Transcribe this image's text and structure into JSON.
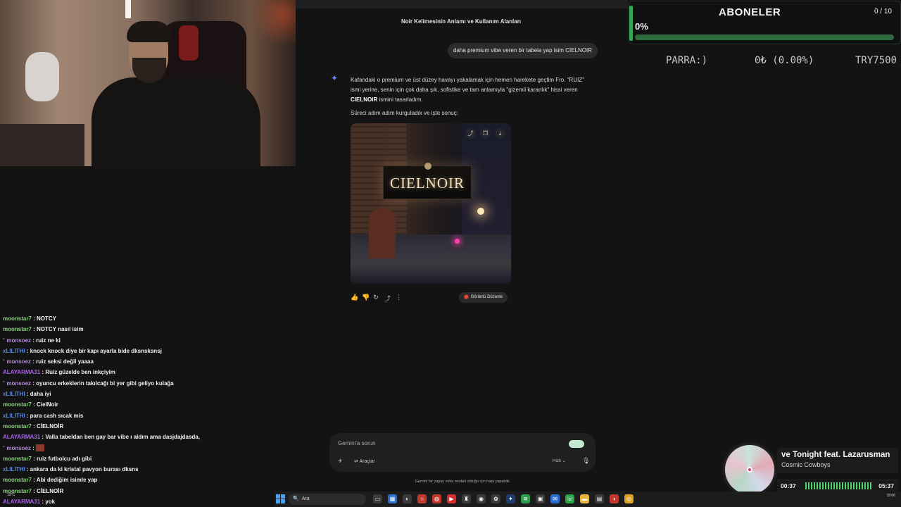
{
  "gemini": {
    "conversation_title": "Noir Kelimesinin Anlamı ve Kullanım Alanları",
    "user_message": "daha premium vibe veren bir tabela yap isim CIELNOIR",
    "reply": {
      "p1_a": "Kafandaki o premium ve üst düzey havayı yakalamak için hemen harekete geçtim Fro. \"RUIZ\" ismi yerine, senin için çok daha şık, sofistike ve tam anlamıyla \"gizemli karanlık\" hissi veren ",
      "p1_bold": "CIELNOIR",
      "p1_b": " ismini tasarladım.",
      "p2": "Süreci adım adım kurguladık ve işte sonuç:"
    },
    "image_sign_text": "CIELNOIR",
    "edit_button": "Görüntü Düzenle",
    "input_placeholder": "Gemini'a sorun",
    "tools_label": "Araçlar",
    "speed_label": "Hızlı",
    "disclaimer": "Gemini bir yapay zeka modeli olduğu için hata yapabilir."
  },
  "goal": {
    "title": "ABONELER",
    "count": "0 / 10",
    "percent_label": "0%",
    "progress": 0.0
  },
  "donation": {
    "label": "PARRA:)",
    "amount": "0₺ (0.00%)",
    "target": "TRY7500"
  },
  "chat": [
    {
      "user": "moonstar7",
      "color": "green",
      "badge": "",
      "text": "NOTCY"
    },
    {
      "user": "moonstar7",
      "color": "green",
      "badge": "",
      "text": "NOTCY nasıl isim"
    },
    {
      "user": "monsoez",
      "color": "purple",
      "badge": "˜",
      "text": "ruiz ne ki"
    },
    {
      "user": "xLILITHI",
      "color": "blue",
      "badge": "",
      "text": "knock knock diye bir kapı ayarla bide dksnsksnsj"
    },
    {
      "user": "monsoez",
      "color": "purple",
      "badge": "˜",
      "text": "ruiz seksi değil yaaaa"
    },
    {
      "user": "ALAYARMA31",
      "color": "violet",
      "badge": "",
      "text": "Ruiz güzelde ben inkçiyim"
    },
    {
      "user": "monsoez",
      "color": "purple",
      "badge": "˜",
      "text": "oyuncu erkeklerin takılcağı bi yer gibi geliyo kulağa"
    },
    {
      "user": "xLILITHI",
      "color": "blue",
      "badge": "",
      "text": "daha iyi"
    },
    {
      "user": "moonstar7",
      "color": "green",
      "badge": "",
      "text": "CielNoir"
    },
    {
      "user": "xLILITHI",
      "color": "blue",
      "badge": "",
      "text": "para cash sıcak mis"
    },
    {
      "user": "moonstar7",
      "color": "green",
      "badge": "",
      "text": "CİELNOİR"
    },
    {
      "user": "ALAYARMA31",
      "color": "violet",
      "badge": "",
      "text": "Valla tabeldan ben gay bar vibe ı aldım ama dasjdajdasda,"
    },
    {
      "user": "monsoez",
      "color": "purple",
      "badge": "˜",
      "text": "",
      "emote": true
    },
    {
      "user": "moonstar7",
      "color": "green",
      "badge": "",
      "text": "ruiz futbolcu adı gibi"
    },
    {
      "user": "xLILITHI",
      "color": "blue",
      "badge": "",
      "text": "ankara da ki kristal pavyon burası dksns"
    },
    {
      "user": "moonstar7",
      "color": "green",
      "badge": "",
      "text": "Abi dediğim isimle yap"
    },
    {
      "user": "moonstar7",
      "color": "green",
      "badge": "",
      "text": "CİELNOİR"
    },
    {
      "user": "ALAYARMA31",
      "color": "violet",
      "badge": "",
      "text": "yok"
    }
  ],
  "music": {
    "title": "ve Tonight feat. Lazarusman",
    "artist": "Cosmic Cowboys",
    "current": "00:37",
    "total": "05:37"
  },
  "taskbar": {
    "search_label": "Ara",
    "weather": "13°C",
    "time": "18:06"
  },
  "colors": {
    "green": "#8ad27a",
    "blue": "#5a86d8",
    "purple": "#b58ad8",
    "violet": "#a562e8",
    "goal_green": "#45c766"
  }
}
